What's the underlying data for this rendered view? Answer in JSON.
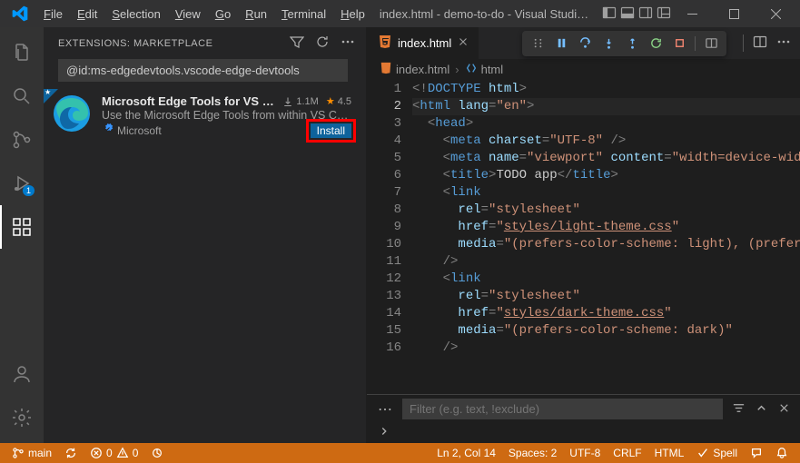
{
  "menu": {
    "file": "File",
    "edit": "Edit",
    "selection": "Selection",
    "view": "View",
    "go": "Go",
    "run": "Run",
    "terminal": "Terminal",
    "help": "Help"
  },
  "title": "index.html - demo-to-do - Visual Studio C…",
  "activity": {
    "debug_badge": "1"
  },
  "sidebar": {
    "title": "EXTENSIONS: MARKETPLACE",
    "search_value": "@id:ms-edgedevtools.vscode-edge-devtools",
    "extension": {
      "name": "Microsoft Edge Tools for VS Code",
      "desc": "Use the Microsoft Edge Tools from within VS Co…",
      "publisher": "Microsoft",
      "installs": "1.1M",
      "rating": "4.5",
      "install_btn": "Install"
    }
  },
  "editor": {
    "tab_name": "index.html",
    "breadcrumbs": {
      "file": "index.html",
      "node": "html"
    },
    "lines": [
      {
        "n": "1",
        "indent": 0,
        "html": "<span class='tok-punct'>&lt;!</span><span class='tok-doctype'>DOCTYPE</span> <span class='tok-attr'>html</span><span class='tok-punct'>&gt;</span>"
      },
      {
        "n": "2",
        "indent": 0,
        "current": true,
        "html": "<span class='tok-punct'>&lt;</span><span class='tok-tag'>html</span> <span class='tok-attr'>lang</span><span class='tok-punct'>=</span><span class='tok-str'>\"en\"</span><span class='tok-punct'>&gt;</span>"
      },
      {
        "n": "3",
        "indent": 1,
        "html": "<span class='tok-punct'>&lt;</span><span class='tok-tag'>head</span><span class='tok-punct'>&gt;</span>"
      },
      {
        "n": "4",
        "indent": 2,
        "html": "<span class='tok-punct'>&lt;</span><span class='tok-tag'>meta</span> <span class='tok-attr'>charset</span><span class='tok-punct'>=</span><span class='tok-str'>\"UTF-8\"</span> <span class='tok-punct'>/&gt;</span>"
      },
      {
        "n": "5",
        "indent": 2,
        "html": "<span class='tok-punct'>&lt;</span><span class='tok-tag'>meta</span> <span class='tok-attr'>name</span><span class='tok-punct'>=</span><span class='tok-str'>\"viewport\"</span> <span class='tok-attr'>content</span><span class='tok-punct'>=</span><span class='tok-str'>\"width=device-wid</span>"
      },
      {
        "n": "6",
        "indent": 2,
        "html": "<span class='tok-punct'>&lt;</span><span class='tok-tag'>title</span><span class='tok-punct'>&gt;</span>TODO app<span class='tok-punct'>&lt;/</span><span class='tok-tag'>title</span><span class='tok-punct'>&gt;</span>"
      },
      {
        "n": "7",
        "indent": 2,
        "html": "<span class='tok-punct'>&lt;</span><span class='tok-tag'>link</span>"
      },
      {
        "n": "8",
        "indent": 3,
        "html": "<span class='tok-attr'>rel</span><span class='tok-punct'>=</span><span class='tok-str'>\"stylesheet\"</span>"
      },
      {
        "n": "9",
        "indent": 3,
        "html": "<span class='tok-attr'>href</span><span class='tok-punct'>=</span><span class='tok-str'>\"</span><span class='tok-href'>styles/light-theme.css</span><span class='tok-str'>\"</span>"
      },
      {
        "n": "10",
        "indent": 3,
        "html": "<span class='tok-attr'>media</span><span class='tok-punct'>=</span><span class='tok-str'>\"(prefers-color-scheme: light), (prefer</span>"
      },
      {
        "n": "11",
        "indent": 2,
        "html": "<span class='tok-punct'>/&gt;</span>"
      },
      {
        "n": "12",
        "indent": 2,
        "html": "<span class='tok-punct'>&lt;</span><span class='tok-tag'>link</span>"
      },
      {
        "n": "13",
        "indent": 3,
        "html": "<span class='tok-attr'>rel</span><span class='tok-punct'>=</span><span class='tok-str'>\"stylesheet\"</span>"
      },
      {
        "n": "14",
        "indent": 3,
        "html": "<span class='tok-attr'>href</span><span class='tok-punct'>=</span><span class='tok-str'>\"</span><span class='tok-href'>styles/dark-theme.css</span><span class='tok-str'>\"</span>"
      },
      {
        "n": "15",
        "indent": 3,
        "html": "<span class='tok-attr'>media</span><span class='tok-punct'>=</span><span class='tok-str'>\"(prefers-color-scheme: dark)\"</span>"
      },
      {
        "n": "16",
        "indent": 2,
        "html": "<span class='tok-punct'>/&gt;</span>"
      }
    ]
  },
  "panel": {
    "filter_placeholder": "Filter (e.g. text, !exclude)"
  },
  "status": {
    "branch": "main",
    "sync": "",
    "errors": "0",
    "warnings": "0",
    "cursor": "Ln 2, Col 14",
    "spaces": "Spaces: 2",
    "encoding": "UTF-8",
    "eol": "CRLF",
    "lang": "HTML",
    "spell": "Spell"
  }
}
